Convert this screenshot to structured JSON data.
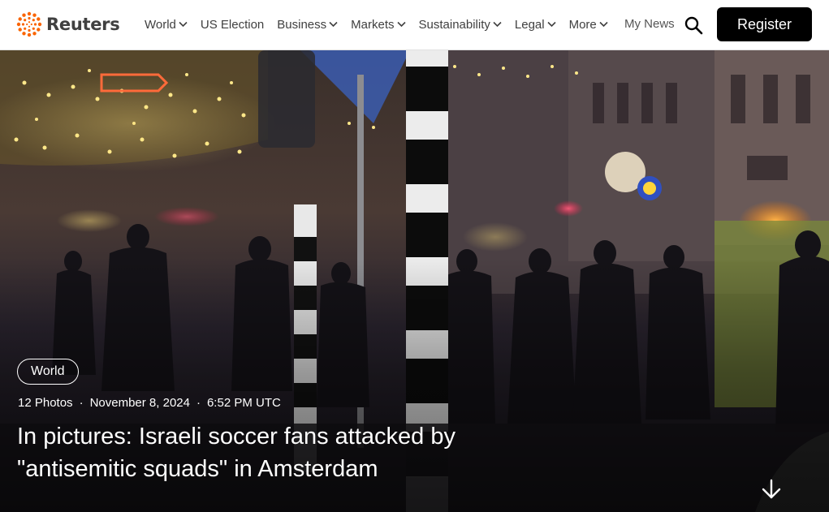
{
  "header": {
    "brand": "Reuters",
    "nav": [
      {
        "label": "World",
        "dropdown": true
      },
      {
        "label": "US Election",
        "dropdown": false
      },
      {
        "label": "Business",
        "dropdown": true
      },
      {
        "label": "Markets",
        "dropdown": true
      },
      {
        "label": "Sustainability",
        "dropdown": true
      },
      {
        "label": "Legal",
        "dropdown": true
      },
      {
        "label": "More",
        "dropdown": true
      }
    ],
    "my_news": "My News",
    "search_icon": "search-icon",
    "register_label": "Register"
  },
  "hero": {
    "tag": "World",
    "photo_count": "12 Photos",
    "date": "November 8, 2024",
    "time": "6:52 PM UTC",
    "separator": "·",
    "headline": "In pictures: Israeli soccer fans attacked by \"antisemitic squads\" in Amsterdam",
    "scroll_icon": "arrow-down-icon"
  },
  "colors": {
    "brand_orange": "#fa6400",
    "text": "#404040",
    "register_bg": "#000000"
  }
}
